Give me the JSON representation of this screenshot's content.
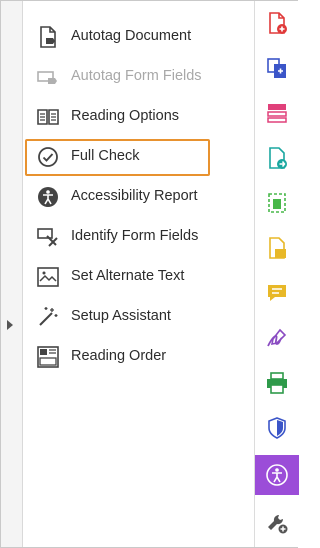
{
  "tools": [
    {
      "label": "Autotag Document",
      "icon": "autotag-document-icon",
      "enabled": true
    },
    {
      "label": "Autotag Form Fields",
      "icon": "autotag-form-fields-icon",
      "enabled": false
    },
    {
      "label": "Reading Options",
      "icon": "reading-options-icon",
      "enabled": true
    },
    {
      "label": "Full Check",
      "icon": "full-check-icon",
      "enabled": true
    },
    {
      "label": "Accessibility Report",
      "icon": "accessibility-report-icon",
      "enabled": true
    },
    {
      "label": "Identify Form Fields",
      "icon": "identify-form-fields-icon",
      "enabled": true
    },
    {
      "label": "Set Alternate Text",
      "icon": "set-alternate-text-icon",
      "enabled": true
    },
    {
      "label": "Setup Assistant",
      "icon": "setup-assistant-icon",
      "enabled": true
    },
    {
      "label": "Reading Order",
      "icon": "reading-order-icon",
      "enabled": true
    }
  ],
  "highlighted_tool": "Full Check",
  "right_rail": [
    {
      "icon": "create-pdf-icon",
      "color": "#e03a3a"
    },
    {
      "icon": "combine-files-icon",
      "color": "#3b55c8"
    },
    {
      "icon": "organize-pages-icon",
      "color": "#e0407a"
    },
    {
      "icon": "export-pdf-icon",
      "color": "#1aa7a0"
    },
    {
      "icon": "edit-pdf-icon",
      "color": "#48b84a"
    },
    {
      "icon": "comment-icon",
      "color": "#e8b828"
    },
    {
      "icon": "sticky-note-icon",
      "color": "#e8b828"
    },
    {
      "icon": "fill-sign-icon",
      "color": "#8a4cc2"
    },
    {
      "icon": "print-production-icon",
      "color": "#2e9a4a"
    },
    {
      "icon": "protect-icon",
      "color": "#3b55c8"
    },
    {
      "icon": "accessibility-icon",
      "color": "#9b4dd8",
      "active": true
    },
    {
      "icon": "more-tools-icon",
      "color": "#555555"
    }
  ],
  "colors": {
    "highlight": "#e8922f",
    "active_rail": "#9b4dd8"
  }
}
